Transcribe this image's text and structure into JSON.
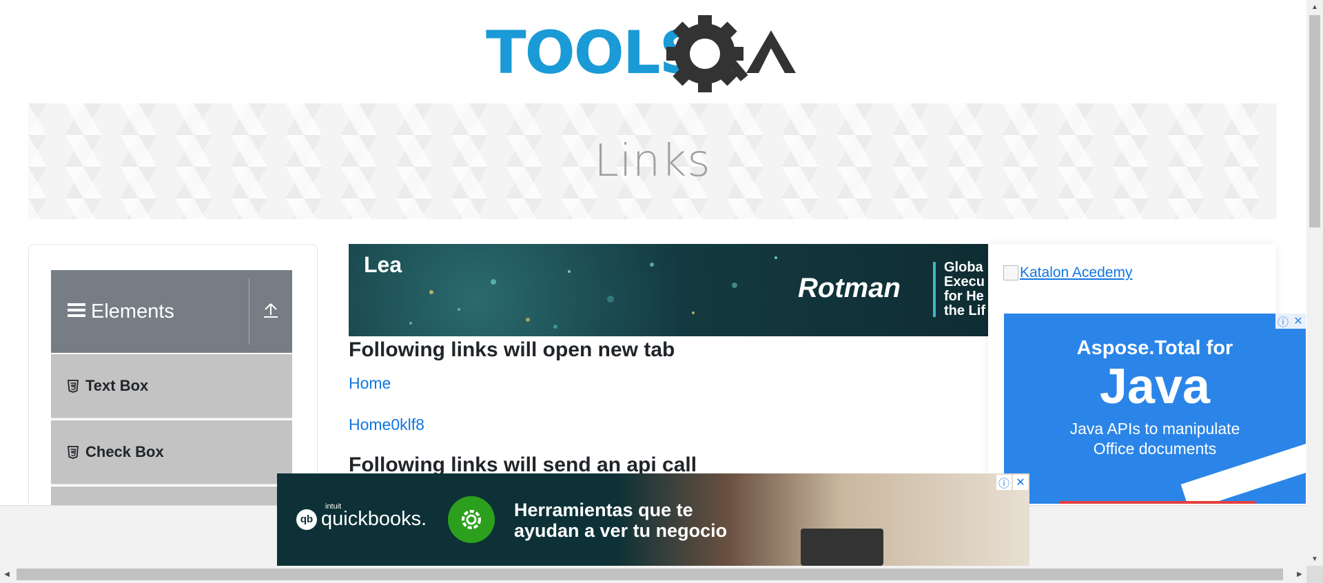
{
  "logo": {
    "text_main": "TOOLS",
    "text_q": "Q",
    "text_a": "A",
    "color_main": "#1a9ad6",
    "color_gear": "#333333"
  },
  "banner": {
    "title": "Links"
  },
  "sidebar": {
    "group_label": "Elements",
    "group_icon": "hamburger-icon",
    "toggle_icon": "upload-arrow-icon",
    "items": [
      {
        "label": "Text Box",
        "icon": "html5-icon"
      },
      {
        "label": "Check Box",
        "icon": "html5-icon"
      }
    ]
  },
  "ad_top": {
    "lead": "Lea",
    "brand": "Rotman",
    "side_lines": [
      "Globa",
      "Execu",
      "for He",
      "the Lif"
    ]
  },
  "main": {
    "heading_new_tab": "Following links will open new tab",
    "links": [
      "Home",
      "Home0klf8"
    ],
    "heading_api": "Following links will send an api call"
  },
  "right": {
    "katalon_alt": "Katalon Acedemy",
    "ad_line1": "Aspose.Total for",
    "ad_line2": "Java",
    "ad_line3a": "Java APIs to manipulate",
    "ad_line3b": "Office documents"
  },
  "ad_bottom": {
    "brand_small": "intuit",
    "brand": "quickbooks.",
    "msg_line1": "Herramientas que te",
    "msg_line2": "ayudan a ver tu negocio"
  },
  "colors": {
    "accent_link": "#1076e0",
    "sidebar_header": "#767d85",
    "sidebar_item": "#c3c3c3"
  }
}
